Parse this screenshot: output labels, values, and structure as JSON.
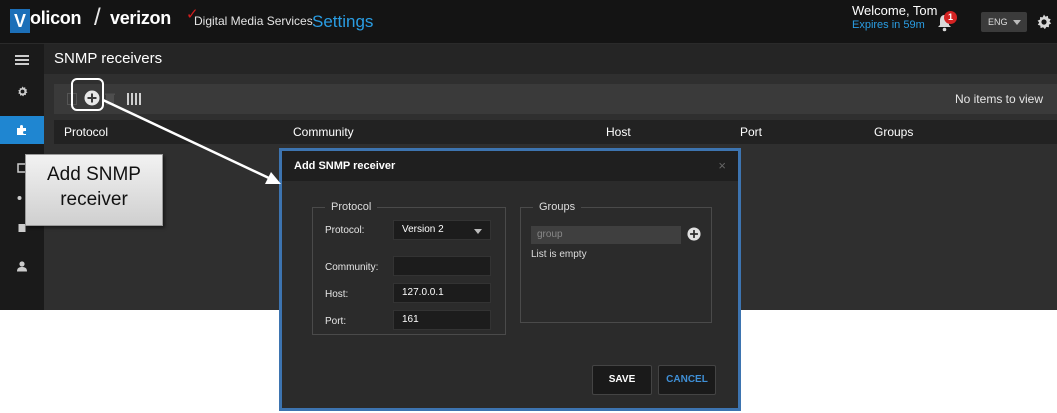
{
  "header": {
    "logo_letter": "V",
    "logo_rest": "olicon",
    "brand_partner": "verizon",
    "brand_services": "Digital Media Services",
    "app_title": "Settings",
    "welcome": "Welcome, Tom",
    "expires": "Expires in 59m",
    "notification_count": "1",
    "language": "ENG"
  },
  "sidebar": {
    "items": [
      {
        "icon": "menu-icon",
        "active": false
      },
      {
        "icon": "gear-icon",
        "active": false
      },
      {
        "icon": "puzzle-icon",
        "active": true
      },
      {
        "icon": "user-icon",
        "active": false
      }
    ]
  },
  "page": {
    "title": "SNMP receivers",
    "no_items": "No items to view",
    "columns": [
      "Protocol",
      "Community",
      "Host",
      "Port",
      "Groups"
    ]
  },
  "modal": {
    "title": "Add SNMP receiver",
    "close": "×",
    "protocol_legend": "Protocol",
    "protocol_label": "Protocol:",
    "protocol_value": "Version 2",
    "community_label": "Community:",
    "community_value": "",
    "host_label": "Host:",
    "host_value": "127.0.0.1",
    "port_label": "Port:",
    "port_value": "161",
    "groups_legend": "Groups",
    "group_placeholder": "group",
    "groups_empty": "List is empty",
    "save": "SAVE",
    "cancel": "CANCEL"
  },
  "annotation": {
    "line1": "Add SNMP",
    "line2": "receiver"
  },
  "colors": {
    "accent": "#1f86d1",
    "modal_border": "#3d74b0",
    "badge": "#d42323"
  }
}
